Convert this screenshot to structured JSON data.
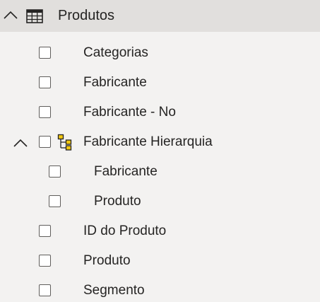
{
  "table": {
    "name": "Produtos",
    "icon": "table-icon",
    "expanded": true
  },
  "fields": [
    {
      "label": "Categorias",
      "checked": false
    },
    {
      "label": "Fabricante",
      "checked": false
    },
    {
      "label": "Fabricante - No",
      "checked": false
    }
  ],
  "hierarchy": {
    "label": "Fabricante Hierarquia",
    "icon": "hierarchy-icon",
    "expanded": true,
    "checked": false,
    "levels": [
      {
        "label": "Fabricante",
        "checked": false
      },
      {
        "label": "Produto",
        "checked": false
      }
    ]
  },
  "fields_after": [
    {
      "label": "ID do Produto",
      "checked": false
    },
    {
      "label": "Produto",
      "checked": false
    },
    {
      "label": "Segmento",
      "checked": false
    }
  ],
  "colors": {
    "header_background": "#e1dfdd",
    "pane_background": "#f3f2f1",
    "hierarchy_icon_fill": "#f2c811"
  }
}
